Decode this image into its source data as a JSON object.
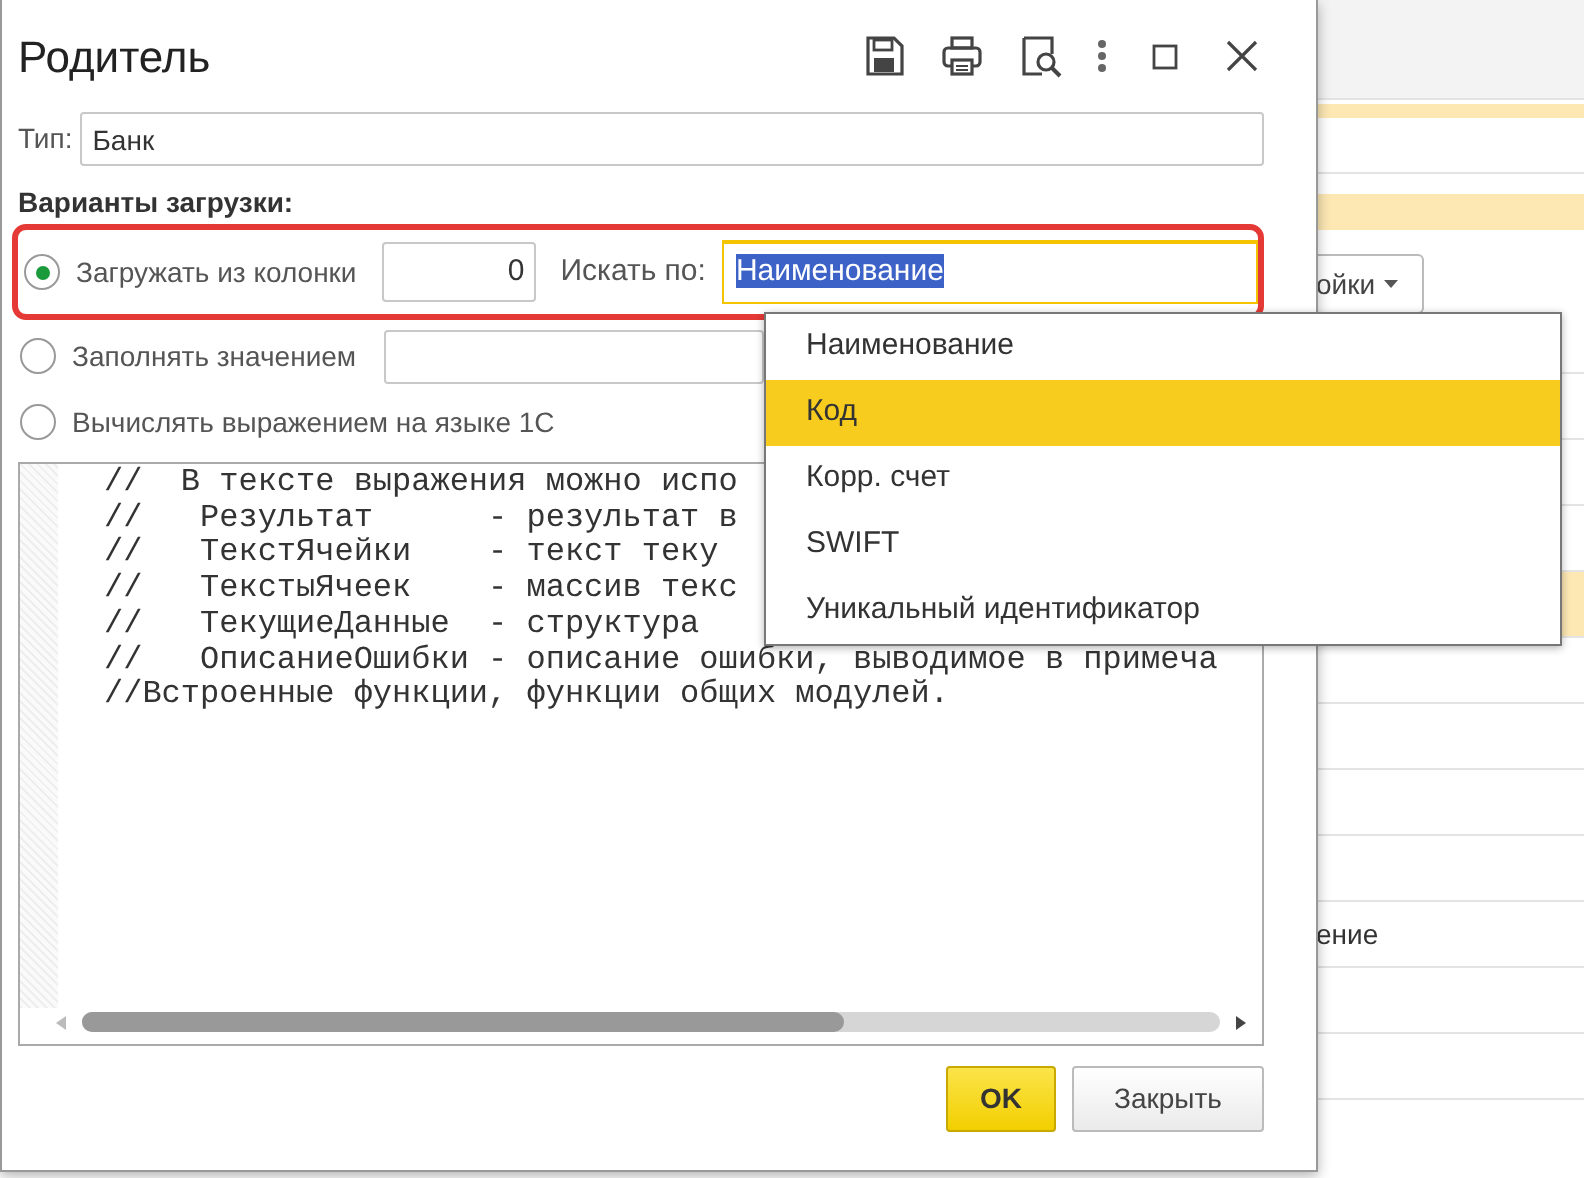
{
  "window": {
    "title": "Родитель"
  },
  "type_field": {
    "label": "Тип:",
    "value": "Банк"
  },
  "load_options": {
    "heading": "Варианты загрузки:",
    "options": [
      {
        "kind": "column",
        "label": "Загружать из колонки",
        "selected": true,
        "column_value": "0",
        "search_label": "Искать по:",
        "search_value": "Наименование"
      },
      {
        "kind": "fill",
        "label": "Заполнять значением",
        "selected": false
      },
      {
        "kind": "expression",
        "label": "Вычислять выражением на языке 1С",
        "selected": false
      }
    ]
  },
  "dropdown": {
    "items": [
      {
        "label": "Наименование",
        "selected": false
      },
      {
        "label": "Код",
        "selected": true
      },
      {
        "label": "Корр. счет",
        "selected": false
      },
      {
        "label": "SWIFT",
        "selected": false
      },
      {
        "label": "Уникальный идентификатор",
        "selected": false
      }
    ]
  },
  "code_editor": {
    "lines": [
      "//  В тексте выражения можно испо",
      "//   Результат      - результат в",
      "//   ТекстЯчейки    - текст теку",
      "//   ТекстыЯчеек    - массив текс",
      "//   ТекущиеДанные  - структура",
      "//   ОписаниеОшибки - описание ошибки, выводимое в примеча",
      "//Встроенные функции, функции общих модулей."
    ]
  },
  "buttons": [
    {
      "label": "OK",
      "kind": "default"
    },
    {
      "label": "Закрыть",
      "kind": "normal"
    }
  ],
  "background": {
    "button_label": "ойки",
    "row_text": "ение"
  }
}
